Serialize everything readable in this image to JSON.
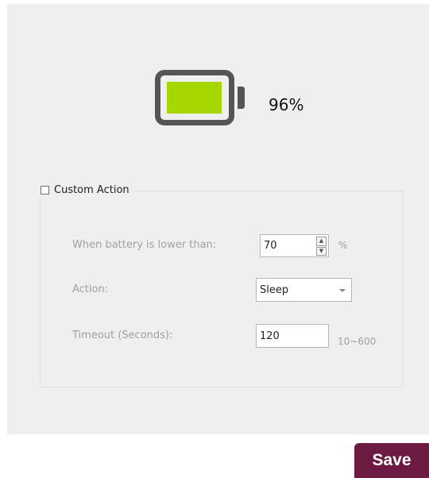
{
  "battery": {
    "percent_label": "96%",
    "level": 0.96,
    "fill_color": "#a6d700",
    "icon": "battery-icon"
  },
  "custom_action": {
    "checkbox_label": "Custom Action",
    "checked": false,
    "threshold_label": "When battery is lower than:",
    "threshold_value": "70",
    "threshold_unit": "%",
    "action_label": "Action:",
    "action_selected": "Sleep",
    "timeout_label": "Timeout (Seconds):",
    "timeout_value": "120",
    "timeout_range": "10~600"
  },
  "footer": {
    "save_label": "Save",
    "save_color": "#6d1a43"
  }
}
